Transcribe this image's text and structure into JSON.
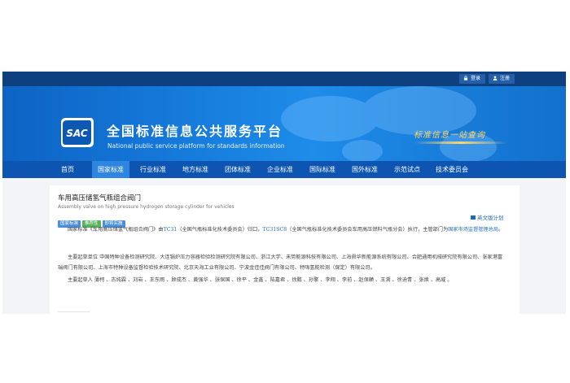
{
  "colors": {
    "topbar": "#0e3f7f",
    "banner": "#1579da",
    "nav": "#0d55b0",
    "nav_active": "#2f86e0",
    "badge_blue": "#4a8fd8",
    "badge_green": "#56b35a",
    "link": "#2a6fc0"
  },
  "header": {
    "login_label": "登录",
    "login_icon": "lock-icon",
    "register_label": "注册",
    "register_icon": "user-icon",
    "logo_text": "SAC",
    "title_cn": "全国标准信息公共服务平台",
    "title_en": "National public service platform  for standards information",
    "slogan": "标准信息一站查询"
  },
  "nav": {
    "items": [
      {
        "label": "首页"
      },
      {
        "label": "国家标准",
        "active": true
      },
      {
        "label": "行业标准"
      },
      {
        "label": "地方标准"
      },
      {
        "label": "团体标准"
      },
      {
        "label": "企业标准"
      },
      {
        "label": "国际标准"
      },
      {
        "label": "国外标准"
      },
      {
        "label": "示范试点"
      },
      {
        "label": "技术委员会"
      }
    ]
  },
  "standard": {
    "title": "车用高压储氢气瓶组合阀门",
    "title_en": "Assembly valve on high pressure hydrogen storage cylinder for vehicles",
    "badges": [
      {
        "label": "国家标准",
        "color": "#4a8fd8"
      },
      {
        "label": "推荐性",
        "color": "#56b35a"
      },
      {
        "label": "即将实施",
        "color": "#4a8fd8"
      }
    ],
    "plan_link": "英文版计划",
    "para1": {
      "a": "国家标准《车用高压储氢气瓶组合阀门》由",
      "tc": "TC31",
      "b": "（全国气瓶标准化技术委员会）归口，",
      "sc": "TC31SC8",
      "c": "（全国气瓶标准化技术委员会车用高压燃料气瓶分会）执行，主管部门为",
      "dept": "国家市场监督管理总局",
      "d": "。"
    },
    "para2": "主要起草单位 中国特种设备检测研究院、大连锅炉压力容器检验检测研究院有限公司、浙江大学、未势能源科技有限公司、上海舜华新能源系统有限公司、合肥通用机械研究院有限公司、张家港富瑞阀门有限公司、上海市特种设备监督检验技术研究院、北京天海工业有限公司、宁波金佳佳阀门有限公司、特嗨氢能检测（保定）有限公司。",
    "para3": "主要起草人 薄柯 、古纯霖 、刘岩 、王东雨 、顾成杰 、黄强华 、张保国 、徐平 、金鑫 、陆嘉君 、徐鹏 、孙擎 、李翔 、李前 、赵保頔 、王溯 、徐迪青 、张焕 、高威 。"
  }
}
